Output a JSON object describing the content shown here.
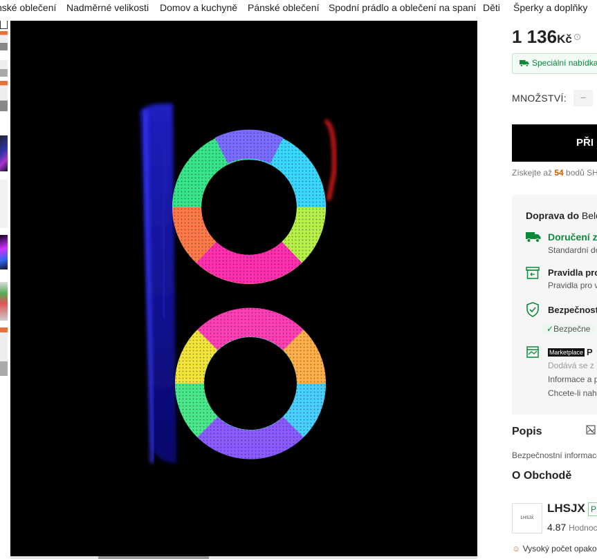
{
  "nav": {
    "categories": [
      "nské oblečení",
      "Nadměrné velikosti",
      "Domov a kuchyně",
      "Pánské oblečení",
      "Spodní prádlo a oblečení na spaní",
      "Děti",
      "Šperky a doplňky"
    ]
  },
  "product": {
    "price": "1 136",
    "currency": "Kč",
    "info_symbol": "i",
    "special_offer": "Speciální nabídka",
    "quantity_label": "MNOŽSTVÍ:",
    "quantity_minus": "−",
    "add_button": "PŘI",
    "points_prefix": "Získejte až ",
    "points_value": "54",
    "points_suffix": " bodů SH"
  },
  "shipping": {
    "title_bold": "Doprava do",
    "title_rest": " Belo",
    "delivery_head": "Doručení z",
    "delivery_sub": "Standardní do",
    "returns_head": "Pravidla pro",
    "returns_sub": "Pravidla pro v",
    "security_head": "Bezpečnost",
    "security_sub": "Bezpečne",
    "marketplace_badge": "Marketplace",
    "marketplace_head": "P",
    "marketplace_sub1": "Dodává se z S",
    "marketplace_sub2": "Informace a p",
    "marketplace_sub3": "Chcete-li nah"
  },
  "description": {
    "title": "Popis",
    "safety": "Bezpečnostní informace"
  },
  "store": {
    "title": "O Obchodě",
    "logo_text": "LHSJX",
    "name": "LHSJX",
    "tag": "P",
    "rating": "4.87",
    "rating_label": "Hodnoc",
    "repeat": "Vysoký počet opako"
  },
  "colors": {
    "accent_green": "#0a8a3a",
    "points_orange": "#c95a00",
    "button_black": "#000000"
  },
  "icons": [
    "truck-icon",
    "info-icon",
    "return-box-icon",
    "shield-check-icon",
    "store-icon",
    "image-search-icon",
    "person-icon",
    "check-icon"
  ]
}
